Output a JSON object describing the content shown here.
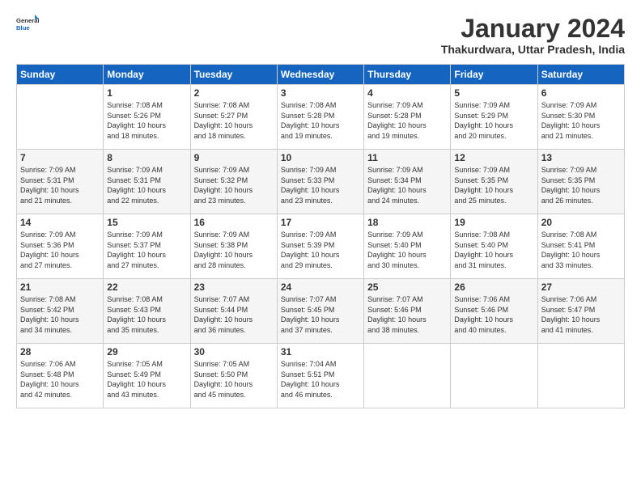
{
  "logo": {
    "line1": "General",
    "line2": "Blue"
  },
  "title": "January 2024",
  "location": "Thakurdwara, Uttar Pradesh, India",
  "weekdays": [
    "Sunday",
    "Monday",
    "Tuesday",
    "Wednesday",
    "Thursday",
    "Friday",
    "Saturday"
  ],
  "weeks": [
    [
      {
        "day": "",
        "info": ""
      },
      {
        "day": "1",
        "info": "Sunrise: 7:08 AM\nSunset: 5:26 PM\nDaylight: 10 hours\nand 18 minutes."
      },
      {
        "day": "2",
        "info": "Sunrise: 7:08 AM\nSunset: 5:27 PM\nDaylight: 10 hours\nand 18 minutes."
      },
      {
        "day": "3",
        "info": "Sunrise: 7:08 AM\nSunset: 5:28 PM\nDaylight: 10 hours\nand 19 minutes."
      },
      {
        "day": "4",
        "info": "Sunrise: 7:09 AM\nSunset: 5:28 PM\nDaylight: 10 hours\nand 19 minutes."
      },
      {
        "day": "5",
        "info": "Sunrise: 7:09 AM\nSunset: 5:29 PM\nDaylight: 10 hours\nand 20 minutes."
      },
      {
        "day": "6",
        "info": "Sunrise: 7:09 AM\nSunset: 5:30 PM\nDaylight: 10 hours\nand 21 minutes."
      }
    ],
    [
      {
        "day": "7",
        "info": "Sunrise: 7:09 AM\nSunset: 5:31 PM\nDaylight: 10 hours\nand 21 minutes."
      },
      {
        "day": "8",
        "info": "Sunrise: 7:09 AM\nSunset: 5:31 PM\nDaylight: 10 hours\nand 22 minutes."
      },
      {
        "day": "9",
        "info": "Sunrise: 7:09 AM\nSunset: 5:32 PM\nDaylight: 10 hours\nand 23 minutes."
      },
      {
        "day": "10",
        "info": "Sunrise: 7:09 AM\nSunset: 5:33 PM\nDaylight: 10 hours\nand 23 minutes."
      },
      {
        "day": "11",
        "info": "Sunrise: 7:09 AM\nSunset: 5:34 PM\nDaylight: 10 hours\nand 24 minutes."
      },
      {
        "day": "12",
        "info": "Sunrise: 7:09 AM\nSunset: 5:35 PM\nDaylight: 10 hours\nand 25 minutes."
      },
      {
        "day": "13",
        "info": "Sunrise: 7:09 AM\nSunset: 5:35 PM\nDaylight: 10 hours\nand 26 minutes."
      }
    ],
    [
      {
        "day": "14",
        "info": "Sunrise: 7:09 AM\nSunset: 5:36 PM\nDaylight: 10 hours\nand 27 minutes."
      },
      {
        "day": "15",
        "info": "Sunrise: 7:09 AM\nSunset: 5:37 PM\nDaylight: 10 hours\nand 27 minutes."
      },
      {
        "day": "16",
        "info": "Sunrise: 7:09 AM\nSunset: 5:38 PM\nDaylight: 10 hours\nand 28 minutes."
      },
      {
        "day": "17",
        "info": "Sunrise: 7:09 AM\nSunset: 5:39 PM\nDaylight: 10 hours\nand 29 minutes."
      },
      {
        "day": "18",
        "info": "Sunrise: 7:09 AM\nSunset: 5:40 PM\nDaylight: 10 hours\nand 30 minutes."
      },
      {
        "day": "19",
        "info": "Sunrise: 7:08 AM\nSunset: 5:40 PM\nDaylight: 10 hours\nand 31 minutes."
      },
      {
        "day": "20",
        "info": "Sunrise: 7:08 AM\nSunset: 5:41 PM\nDaylight: 10 hours\nand 33 minutes."
      }
    ],
    [
      {
        "day": "21",
        "info": "Sunrise: 7:08 AM\nSunset: 5:42 PM\nDaylight: 10 hours\nand 34 minutes."
      },
      {
        "day": "22",
        "info": "Sunrise: 7:08 AM\nSunset: 5:43 PM\nDaylight: 10 hours\nand 35 minutes."
      },
      {
        "day": "23",
        "info": "Sunrise: 7:07 AM\nSunset: 5:44 PM\nDaylight: 10 hours\nand 36 minutes."
      },
      {
        "day": "24",
        "info": "Sunrise: 7:07 AM\nSunset: 5:45 PM\nDaylight: 10 hours\nand 37 minutes."
      },
      {
        "day": "25",
        "info": "Sunrise: 7:07 AM\nSunset: 5:46 PM\nDaylight: 10 hours\nand 38 minutes."
      },
      {
        "day": "26",
        "info": "Sunrise: 7:06 AM\nSunset: 5:46 PM\nDaylight: 10 hours\nand 40 minutes."
      },
      {
        "day": "27",
        "info": "Sunrise: 7:06 AM\nSunset: 5:47 PM\nDaylight: 10 hours\nand 41 minutes."
      }
    ],
    [
      {
        "day": "28",
        "info": "Sunrise: 7:06 AM\nSunset: 5:48 PM\nDaylight: 10 hours\nand 42 minutes."
      },
      {
        "day": "29",
        "info": "Sunrise: 7:05 AM\nSunset: 5:49 PM\nDaylight: 10 hours\nand 43 minutes."
      },
      {
        "day": "30",
        "info": "Sunrise: 7:05 AM\nSunset: 5:50 PM\nDaylight: 10 hours\nand 45 minutes."
      },
      {
        "day": "31",
        "info": "Sunrise: 7:04 AM\nSunset: 5:51 PM\nDaylight: 10 hours\nand 46 minutes."
      },
      {
        "day": "",
        "info": ""
      },
      {
        "day": "",
        "info": ""
      },
      {
        "day": "",
        "info": ""
      }
    ]
  ]
}
